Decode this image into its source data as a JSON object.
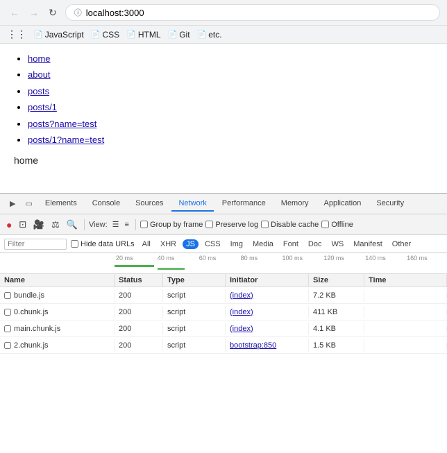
{
  "browser": {
    "url": "localhost:3000",
    "nav": {
      "back_label": "←",
      "forward_label": "→",
      "reload_label": "↻"
    },
    "bookmarks": [
      {
        "label": "JavaScript",
        "icon": "📄"
      },
      {
        "label": "CSS",
        "icon": "📄"
      },
      {
        "label": "HTML",
        "icon": "📄"
      },
      {
        "label": "Git",
        "icon": "📄"
      },
      {
        "label": "etc.",
        "icon": "📄"
      }
    ]
  },
  "page": {
    "links": [
      {
        "text": "home",
        "href": "home"
      },
      {
        "text": "about",
        "href": "about"
      },
      {
        "text": "posts",
        "href": "posts"
      },
      {
        "text": "posts/1",
        "href": "posts/1"
      },
      {
        "text": "posts?name=test",
        "href": "posts?name=test"
      },
      {
        "text": "posts/1?name=test",
        "href": "posts/1?name=test"
      }
    ],
    "heading": "home"
  },
  "devtools": {
    "tabs": [
      {
        "label": "Elements"
      },
      {
        "label": "Console"
      },
      {
        "label": "Sources"
      },
      {
        "label": "Network",
        "active": true
      },
      {
        "label": "Performance"
      },
      {
        "label": "Memory"
      },
      {
        "label": "Application"
      },
      {
        "label": "Security"
      }
    ],
    "toolbar": {
      "view_label": "View:",
      "group_by_frame_label": "Group by frame",
      "preserve_log_label": "Preserve log",
      "disable_cache_label": "Disable cache",
      "offline_label": "Offline"
    },
    "filter": {
      "placeholder": "Filter",
      "hide_data_urls_label": "Hide data URLs",
      "tags": [
        "All",
        "XHR",
        "JS",
        "CSS",
        "Img",
        "Media",
        "Font",
        "Doc",
        "WS",
        "Manifest",
        "Other"
      ]
    },
    "timeline": {
      "labels": [
        "20 ms",
        "40 ms",
        "60 ms",
        "80 ms",
        "100 ms",
        "120 ms",
        "140 ms",
        "160 ms"
      ]
    },
    "table": {
      "headers": [
        "Name",
        "Status",
        "Type",
        "Initiator",
        "Size",
        "Time"
      ],
      "rows": [
        {
          "name": "bundle.js",
          "status": "200",
          "type": "script",
          "initiator": "(index)",
          "size": "7.2 KB"
        },
        {
          "name": "0.chunk.js",
          "status": "200",
          "type": "script",
          "initiator": "(index)",
          "size": "411 KB"
        },
        {
          "name": "main.chunk.js",
          "status": "200",
          "type": "script",
          "initiator": "(index)",
          "size": "4.1 KB"
        },
        {
          "name": "2.chunk.js",
          "status": "200",
          "type": "script",
          "initiator": "bootstrap:850",
          "size": "1.5 KB"
        }
      ]
    }
  }
}
